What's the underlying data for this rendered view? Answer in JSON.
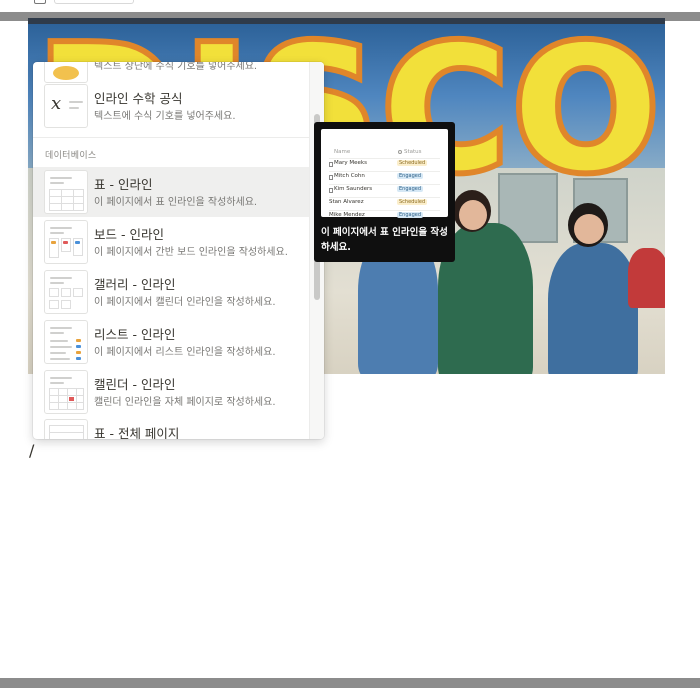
{
  "photo": {
    "sign_text": "DISCO",
    "sign_fill": "#f2e03a",
    "sign_outline": "#e0862a"
  },
  "editor": {
    "typed_text": "/"
  },
  "menu": {
    "partial_item_desc": "텍스트 상단에 수식 기호를 넣어주세요.",
    "items_before": [
      {
        "title": "인라인 수학 공식",
        "desc": "텍스트에 수식 기호를 넣어주세요.",
        "icon": "math-formula-icon"
      }
    ],
    "section_label": "데이터베이스",
    "database_items": [
      {
        "title": "표 - 인라인",
        "desc": "이 페이지에서 표 인라인을 작성하세요.",
        "icon": "table-inline-icon",
        "hovered": true
      },
      {
        "title": "보드 - 인라인",
        "desc": "이 페이지에서 간반 보드 인라인을 작성하세요.",
        "icon": "board-inline-icon"
      },
      {
        "title": "갤러리 - 인라인",
        "desc": "이 페이지에서 캘린더 인라인을 작성하세요.",
        "icon": "gallery-inline-icon"
      },
      {
        "title": "리스트 - 인라인",
        "desc": "이 페이지에서 리스트 인라인을 작성하세요.",
        "icon": "list-inline-icon"
      },
      {
        "title": "캘린더 - 인라인",
        "desc": "캘린더 인라인을 자체 페이지로 작성하세요.",
        "icon": "calendar-inline-icon"
      },
      {
        "title": "표 - 전체 페이지",
        "desc": "",
        "icon": "table-fullpage-icon"
      }
    ]
  },
  "tooltip": {
    "text": "이 페이지에서 표 인라인을 작성하세요.",
    "preview": {
      "col_name": "Name",
      "col_status": "Status",
      "rows": [
        {
          "name": "Mary Meeks",
          "status": "Scheduled"
        },
        {
          "name": "Mitch Cohn",
          "status": "Engaged"
        },
        {
          "name": "Kim Saunders",
          "status": "Engaged"
        },
        {
          "name": "Stan Alvarez",
          "status": "Scheduled"
        },
        {
          "name": "Mike Mendez",
          "status": "Engaged"
        }
      ],
      "status_colors": {
        "Scheduled": "#fbeecb",
        "Engaged": "#d6e8f5"
      }
    }
  }
}
